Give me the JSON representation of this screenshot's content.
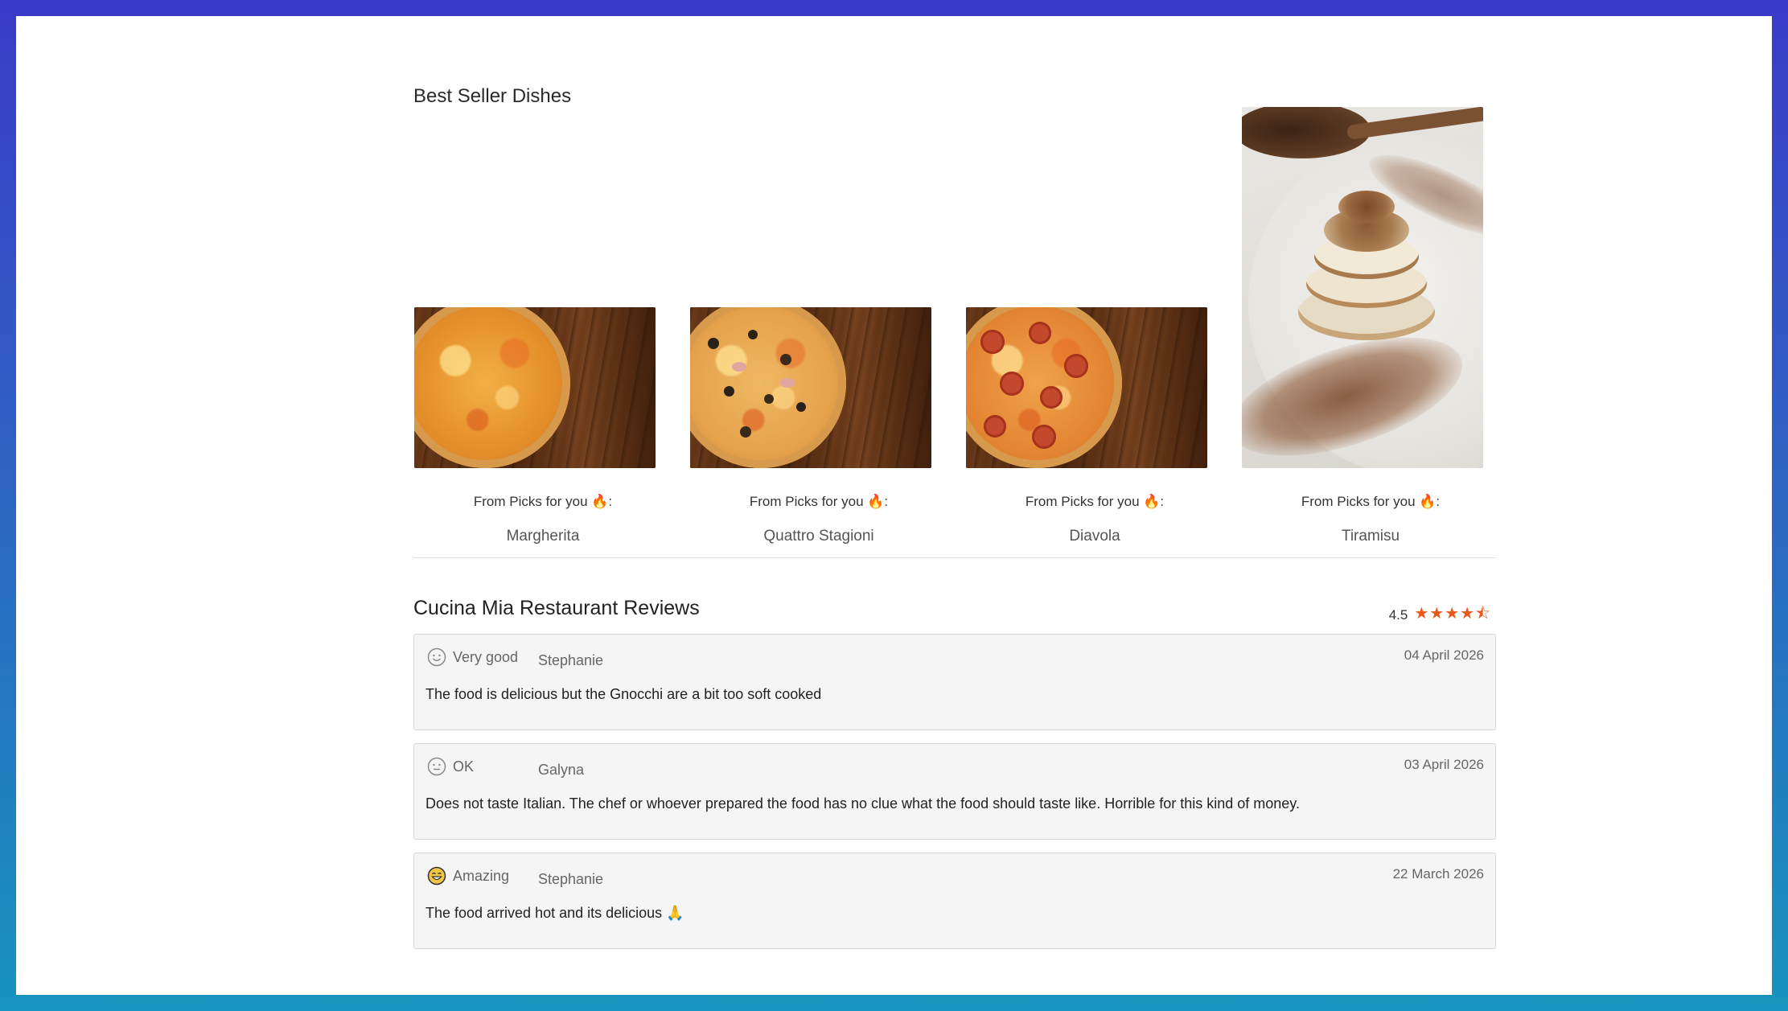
{
  "best_sellers": {
    "title": "Best Seller Dishes",
    "items": [
      {
        "pick_label": "From Picks for you 🔥:",
        "name": "Margherita",
        "image": "pizza-margherita"
      },
      {
        "pick_label": "From Picks for you 🔥:",
        "name": "Quattro Stagioni",
        "image": "pizza-quattro-stagioni"
      },
      {
        "pick_label": "From Picks for you 🔥:",
        "name": "Diavola",
        "image": "pizza-diavola"
      },
      {
        "pick_label": "From Picks for you 🔥:",
        "name": "Tiramisu",
        "image": "tiramisu-dessert"
      }
    ]
  },
  "reviews": {
    "title": "Cucina Mia Restaurant Reviews",
    "rating_value": "4.5",
    "rating_stars": "★★★★⯪",
    "accent_color": "#e8591a",
    "items": [
      {
        "sentiment": "Very good",
        "sentiment_icon": "smile-face-icon",
        "author": "Stephanie",
        "date": "04 April 2026",
        "text": "The food is delicious but the Gnocchi are a bit too soft cooked"
      },
      {
        "sentiment": "OK",
        "sentiment_icon": "neutral-face-icon",
        "author": "Galyna",
        "date": "03 April 2026",
        "text": "Does not taste Italian. The chef or whoever prepared the food has no clue what the food should taste like. Horrible for this kind of money."
      },
      {
        "sentiment": "Amazing",
        "sentiment_icon": "grin-face-icon",
        "author": "Stephanie",
        "date": "22 March 2026",
        "text": "The food arrived hot and its delicious 🙏"
      }
    ]
  }
}
